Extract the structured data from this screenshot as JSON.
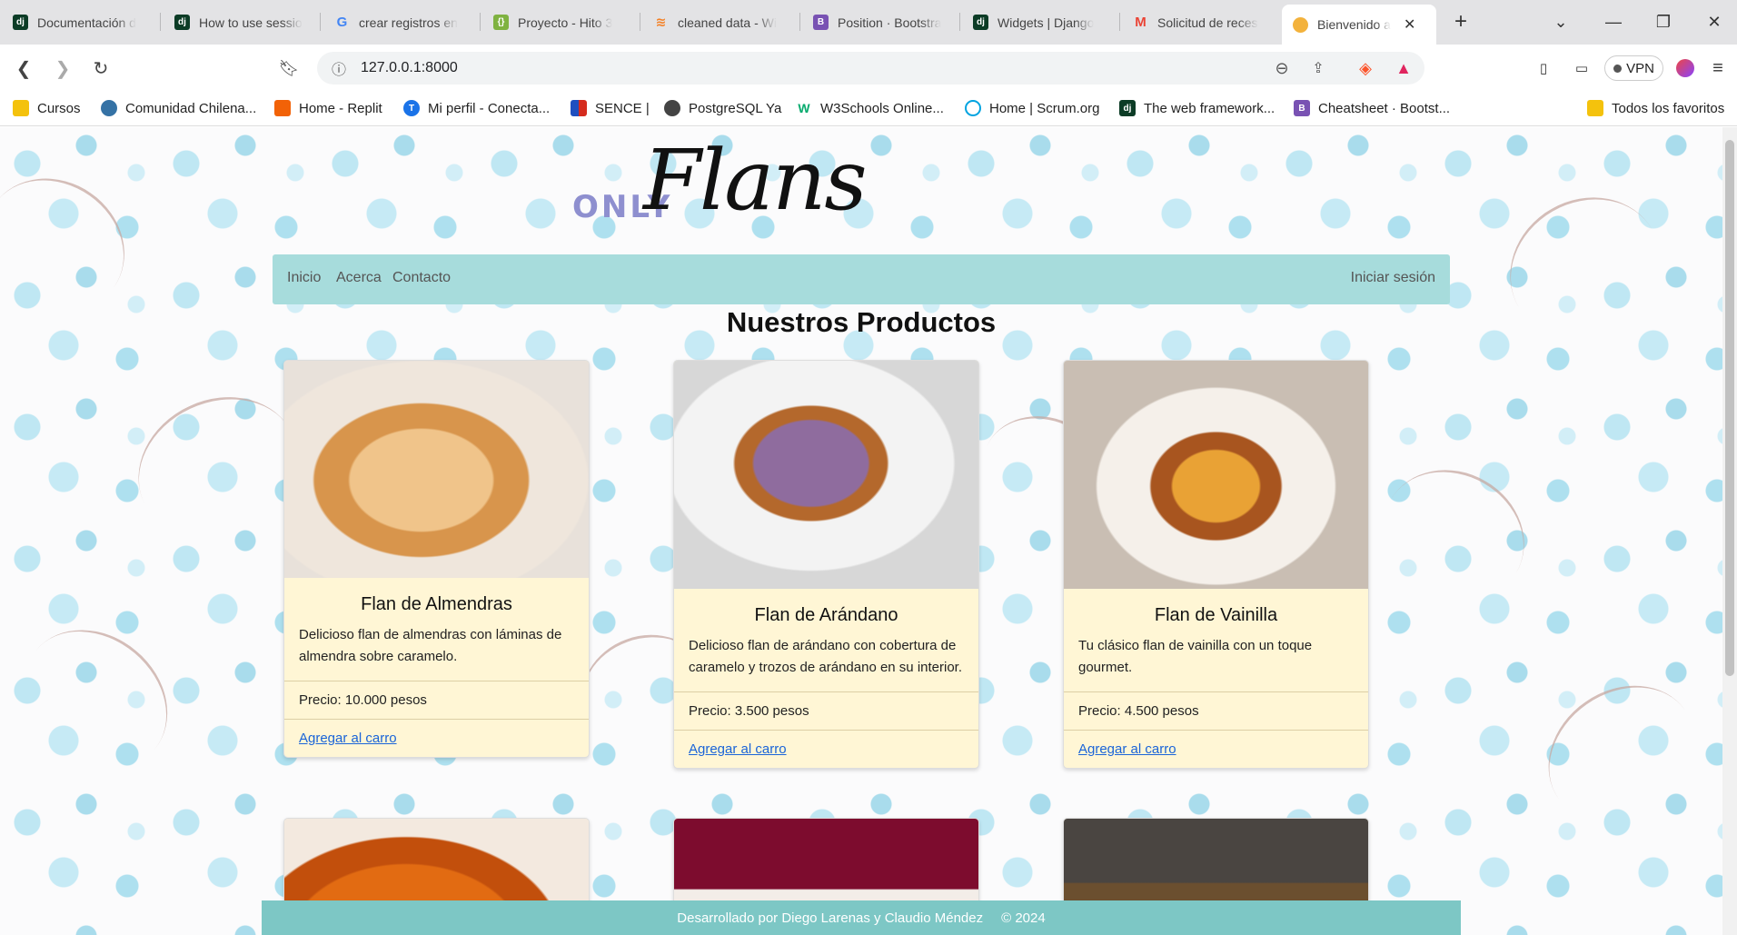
{
  "browser": {
    "tabs": [
      {
        "title": "Documentación d",
        "icon": "django-icon",
        "color": "#0c3c26"
      },
      {
        "title": "How to use sessio",
        "icon": "django-icon",
        "color": "#0c3c26"
      },
      {
        "title": "crear registros en",
        "icon": "google-icon",
        "color": "#ffffff"
      },
      {
        "title": "Proyecto - Hito 3",
        "icon": "hito-icon",
        "color": "#7fb241"
      },
      {
        "title": "cleaned data - Wi",
        "icon": "stack-icon",
        "color": "#f48024"
      },
      {
        "title": "Position · Bootstra",
        "icon": "bootstrap-icon",
        "color": "#7952b3"
      },
      {
        "title": "Widgets | Django",
        "icon": "django-icon",
        "color": "#0c3c26"
      },
      {
        "title": "Solicitud de reces",
        "icon": "gmail-icon",
        "color": "#ea4335"
      }
    ],
    "active_tab": {
      "title": "Bienvenido a",
      "icon": "flan-icon"
    },
    "new_tab": "+",
    "url": "127.0.0.1:8000",
    "vpn": "VPN",
    "bookmarks": [
      {
        "label": "Cursos",
        "icon": "folder-icon",
        "color": "#f4c20d"
      },
      {
        "label": "Comunidad Chilena...",
        "icon": "python-icon",
        "color": "#3572a5"
      },
      {
        "label": "Home - Replit",
        "icon": "replit-icon",
        "color": "#f26207"
      },
      {
        "label": "Mi perfil - Conecta...",
        "icon": "conecta-icon",
        "color": "#1a73e8"
      },
      {
        "label": "SENCE |",
        "icon": "sence-icon",
        "color": "#d52b1e"
      },
      {
        "label": "PostgreSQL Ya",
        "icon": "globe-icon",
        "color": "#444444"
      },
      {
        "label": "W3Schools Online...",
        "icon": "w3schools-icon",
        "color": "#04aa6d"
      },
      {
        "label": "Home | Scrum.org",
        "icon": "scrum-icon",
        "color": "#00a3e0"
      },
      {
        "label": "The web framework...",
        "icon": "django-icon",
        "color": "#0c3c26"
      },
      {
        "label": "Cheatsheet · Bootst...",
        "icon": "bootstrap-icon",
        "color": "#7952b3"
      }
    ],
    "all_bookmarks": "Todos los favoritos"
  },
  "site": {
    "logo_small": "ONLY",
    "logo_script": "Flans",
    "nav": {
      "home": "Inicio",
      "about": "Acerca",
      "contact": "Contacto",
      "login": "Iniciar sesión"
    },
    "heading": "Nuestros Productos",
    "products": [
      {
        "name": "Flan de Almendras",
        "description": "Delicioso flan de almendras con láminas de almendra sobre caramelo.",
        "price": "Precio: 10.000 pesos",
        "cta": "Agregar al carro"
      },
      {
        "name": "Flan de Arándano",
        "description": "Delicioso flan de arándano con cobertura de caramelo y trozos de arándano en su interior.",
        "price": "Precio: 3.500 pesos",
        "cta": "Agregar al carro"
      },
      {
        "name": "Flan de Vainilla",
        "description": "Tu clásico flan de vainilla con un toque gourmet.",
        "price": "Precio: 4.500 pesos",
        "cta": "Agregar al carro"
      }
    ],
    "footer": {
      "credits": "Desarrollado por Diego Larenas y Claudio Méndez",
      "year": "© 2024"
    },
    "colors": {
      "navbar": "#a7dcdc",
      "card": "#fff6d5",
      "footer": "#7dc7c5",
      "link": "#1a64d8",
      "logo_accent": "#8e8fcf"
    }
  }
}
